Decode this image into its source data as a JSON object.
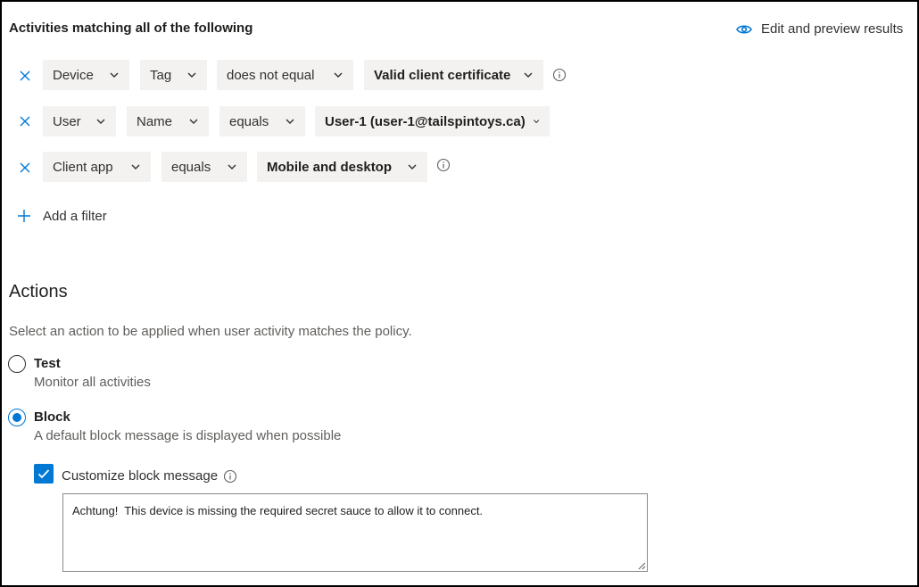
{
  "header": {
    "title": "Activities matching all of the following",
    "edit_preview_label": "Edit and preview results"
  },
  "filters": [
    {
      "field": "Device",
      "subfield": "Tag",
      "operator": "does not equal",
      "value": "Valid client certificate"
    },
    {
      "field": "User",
      "subfield": "Name",
      "operator": "equals",
      "value": "User-1 (user-1@tailspintoys.ca)"
    },
    {
      "field": "Client app",
      "operator": "equals",
      "value": "Mobile and desktop"
    }
  ],
  "add_filter_label": "Add a filter",
  "actions": {
    "heading": "Actions",
    "description": "Select an action to be applied when user activity matches the policy.",
    "options": [
      {
        "label": "Test",
        "sub": "Monitor all activities",
        "selected": false
      },
      {
        "label": "Block",
        "sub": "A default block message is displayed when possible",
        "selected": true
      }
    ],
    "customize": {
      "label": "Customize block message",
      "checked": true,
      "message": "Achtung!  This device is missing the required secret sauce to allow it to connect."
    }
  },
  "colors": {
    "accent": "#0078d4",
    "dropdown_bg": "#f3f2f1",
    "text": "#323130",
    "muted": "#605e5c"
  }
}
